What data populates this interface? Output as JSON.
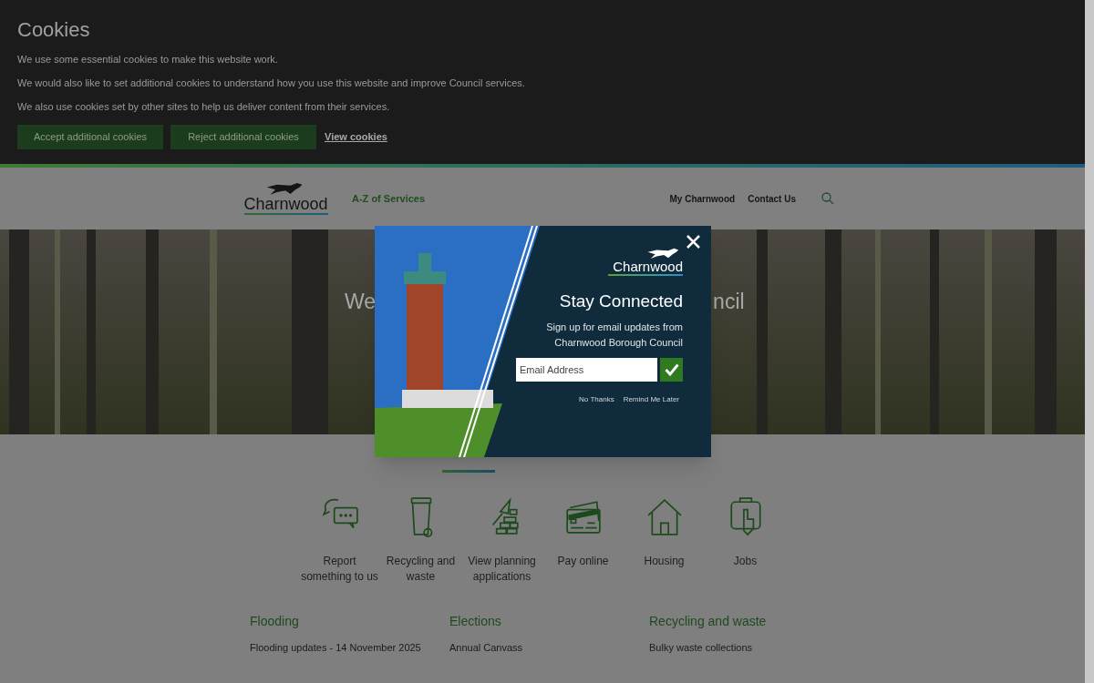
{
  "cookie_banner": {
    "title": "Cookies",
    "paragraphs": [
      "We use some essential cookies to make this website work.",
      "We would also like to set additional cookies to understand how you use this website and improve Council services.",
      "We also use cookies set by other sites to help us deliver content from their services."
    ],
    "buttons": [
      "Accept additional cookies",
      "Reject additional cookies"
    ],
    "link": "View cookies"
  },
  "header": {
    "logo_text": "Charnwood",
    "nav_left": "A-Z of Services",
    "nav_right": [
      "My Charnwood",
      "Contact Us"
    ]
  },
  "hero": {
    "title_fragments": [
      "We",
      "ncil"
    ]
  },
  "popup": {
    "logo_text": "Charnwood",
    "title": "Stay Connected",
    "text": "Sign up for email updates from Charnwood Borough Council",
    "email": {
      "placeholder": "Email Address"
    },
    "links": [
      "No Thanks",
      "Remind Me Later"
    ]
  },
  "services": [
    {
      "label": "Report something to us",
      "kind": "chat"
    },
    {
      "label": "Recycling and waste",
      "kind": "bin"
    },
    {
      "label": "View planning applications",
      "kind": "planning"
    },
    {
      "label": "Pay online",
      "kind": "card"
    },
    {
      "label": "Housing",
      "kind": "house"
    },
    {
      "label": "Jobs",
      "kind": "jobs"
    }
  ],
  "news_columns": [
    {
      "heading": "Flooding",
      "links": [
        "Flooding updates - 14 November 2025"
      ]
    },
    {
      "heading": "Elections",
      "links": [
        "Annual Canvass"
      ]
    },
    {
      "heading": "Recycling and waste",
      "links": [
        "Bulky waste collections"
      ]
    }
  ]
}
